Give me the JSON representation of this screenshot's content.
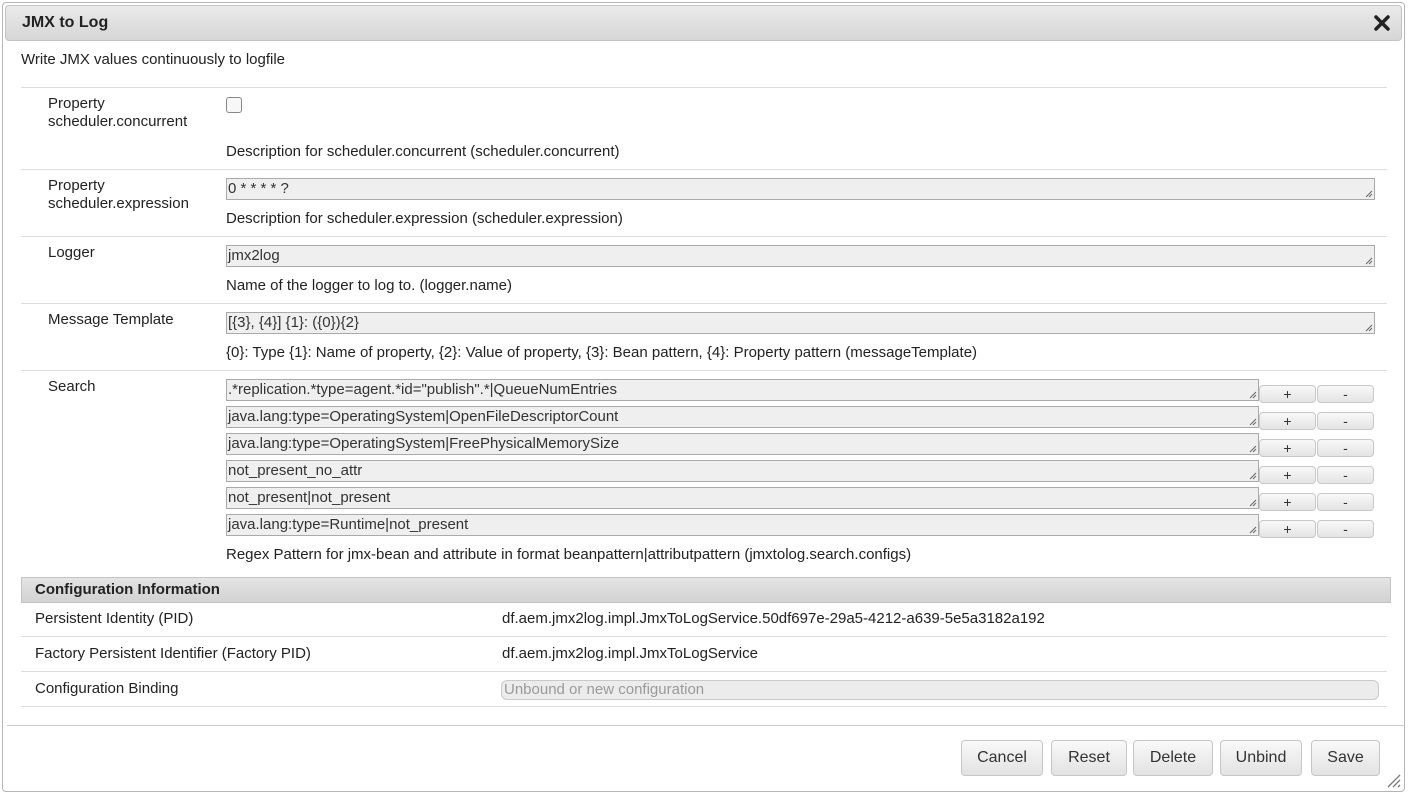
{
  "dialog": {
    "title": "JMX to Log",
    "close_icon": "close-icon",
    "description": "Write JMX values continuously to logfile"
  },
  "properties": {
    "concurrent": {
      "label": "Property scheduler.concurrent",
      "checked": false,
      "description": "Description for scheduler.concurrent (scheduler.concurrent)"
    },
    "expression": {
      "label": "Property scheduler.expression",
      "value": "0 * * * * ?",
      "description": "Description for scheduler.expression (scheduler.expression)"
    },
    "logger": {
      "label": "Logger",
      "value": "jmx2log",
      "description": "Name of the logger to log to. (logger.name)"
    },
    "template": {
      "label": "Message Template",
      "value": "[{3}, {4}] {1}: ({0}){2}",
      "description": "{0}: Type {1}: Name of property, {2}: Value of property, {3}: Bean pattern, {4}: Property pattern (messageTemplate)"
    },
    "search": {
      "label": "Search",
      "plus_label": "+",
      "minus_label": "-",
      "entries": [
        ".*replication.*type=agent.*id=\"publish\".*|QueueNumEntries",
        "java.lang:type=OperatingSystem|OpenFileDescriptorCount",
        "java.lang:type=OperatingSystem|FreePhysicalMemorySize",
        "not_present_no_attr",
        "not_present|not_present",
        "java.lang:type=Runtime|not_present"
      ],
      "description": "Regex Pattern for jmx-bean and attribute in format beanpattern|attributpattern (jmxtolog.search.configs)"
    }
  },
  "config_info": {
    "header": "Configuration Information",
    "pid_label": "Persistent Identity (PID)",
    "pid_value": "df.aem.jmx2log.impl.JmxToLogService.50df697e-29a5-4212-a639-5e5a3182a192",
    "factory_label": "Factory Persistent Identifier (Factory PID)",
    "factory_value": "df.aem.jmx2log.impl.JmxToLogService",
    "binding_label": "Configuration Binding",
    "binding_value": "Unbound or new configuration"
  },
  "buttons": {
    "cancel": "Cancel",
    "reset": "Reset",
    "delete": "Delete",
    "unbind": "Unbind",
    "save": "Save"
  }
}
